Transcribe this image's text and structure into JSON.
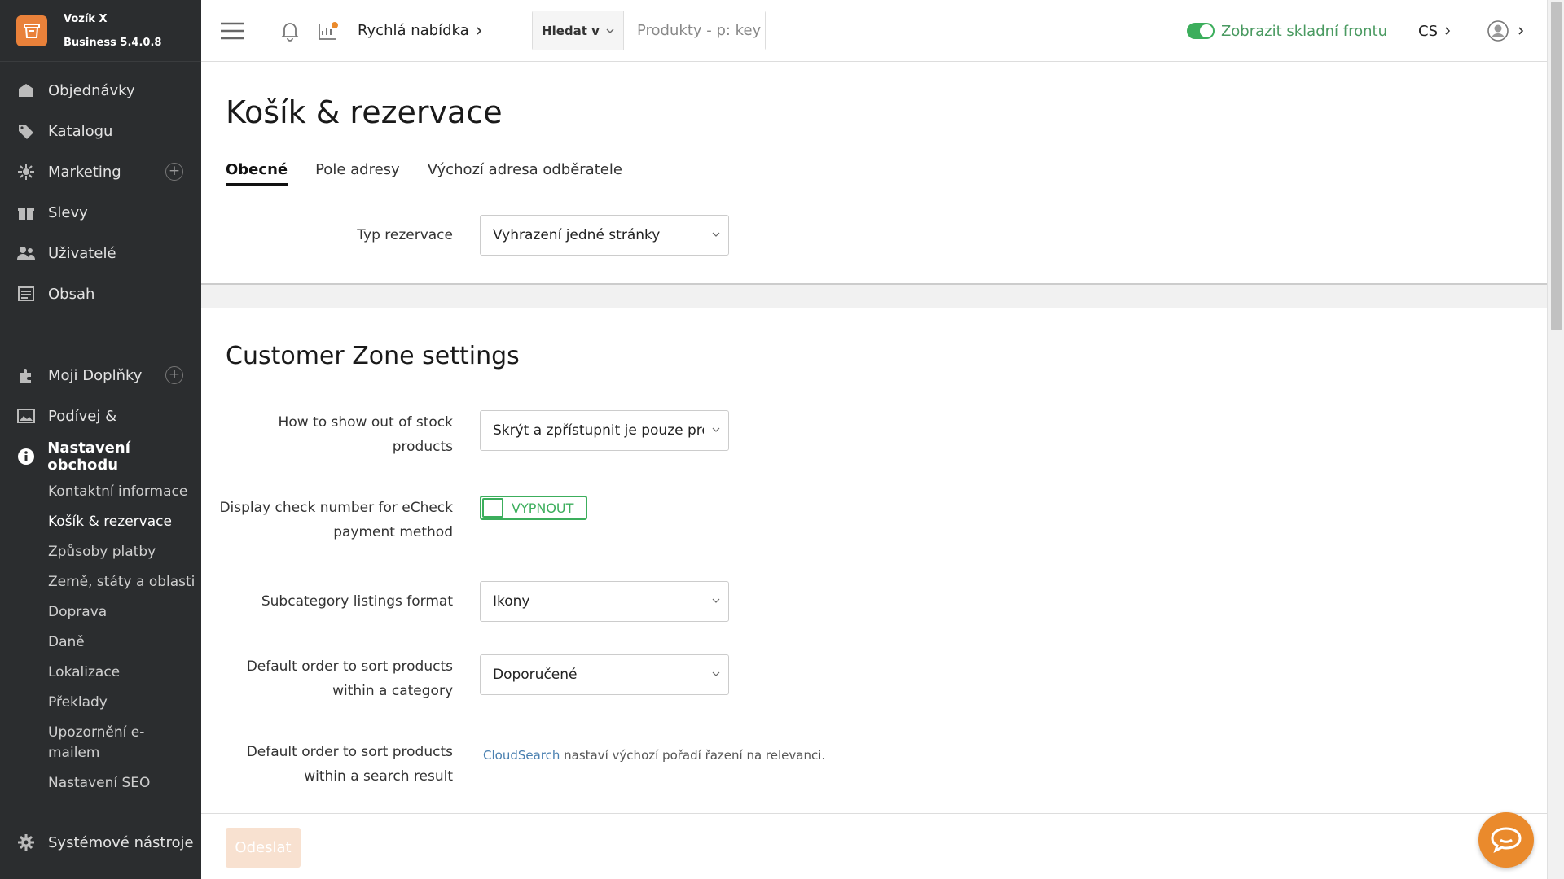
{
  "brand": {
    "name": "Vozík X",
    "edition": "Business 5.4.0.8"
  },
  "sidebar": {
    "items": [
      {
        "label": "Objednávky",
        "icon": "orders-icon"
      },
      {
        "label": "Katalogu",
        "icon": "tags-icon"
      },
      {
        "label": "Marketing",
        "icon": "marketing-icon"
      },
      {
        "label": "Slevy",
        "icon": "gift-icon"
      },
      {
        "label": "Uživatelé",
        "icon": "users-icon"
      },
      {
        "label": "Obsah",
        "icon": "content-icon"
      }
    ],
    "items2": [
      {
        "label": "Moji Doplňky",
        "icon": "puzzle-icon"
      },
      {
        "label": "Podívej &",
        "icon": "image-icon"
      },
      {
        "label": "Nastavení obchodu",
        "icon": "info-icon"
      }
    ],
    "sub": [
      "Kontaktní informace",
      "Košík & rezervace",
      "Způsoby platby",
      "Země, státy a oblasti",
      "Doprava",
      "Daně",
      "Lokalizace",
      "Překlady",
      "Upozornění e-mailem",
      "Nastavení SEO"
    ],
    "system": "Systémové nástroje"
  },
  "topbar": {
    "quick_menu": "Rychlá nabídka",
    "search_in": "Hledat v",
    "search_placeholder": "Produkty - p: key",
    "storefront": "Zobrazit skladní frontu",
    "lang": "CS"
  },
  "page": {
    "title": "Košík & rezervace",
    "tabs": [
      "Obecné",
      "Pole adresy",
      "Výchozí adresa odběratele"
    ],
    "fields": {
      "reservation_type_label": "Typ rezervace",
      "reservation_type_value": "Vyhrazení jedné stránky",
      "section_title": "Customer Zone settings",
      "out_of_stock_label": "How to show out of stock products",
      "out_of_stock_value": "Skrýt a zpřístupnit je pouze prostřednictvím přímého odkazu",
      "echeck_label": "Display check number for eCheck payment method",
      "echeck_value": "VYPNOUT",
      "subcategory_label": "Subcategory listings format",
      "subcategory_value": "Ikony",
      "sort_category_label": "Default order to sort products within a category",
      "sort_category_value": "Doporučené",
      "sort_search_label": "Default order to sort products within a search result",
      "sort_search_link": "CloudSearch",
      "sort_search_hint": " nastaví výchozí pořadí řazení na relevanci."
    },
    "submit": "Odeslat"
  },
  "colors": {
    "accent": "#e9813a",
    "green": "#3cae5c",
    "sidebar": "#2b2d2f"
  }
}
